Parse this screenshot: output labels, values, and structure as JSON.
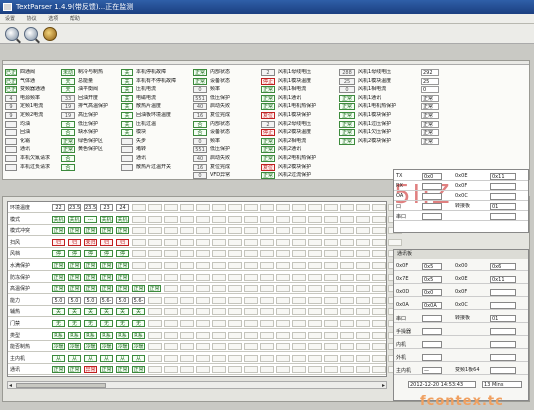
{
  "window": {
    "title": "TextParser 1.4.9(带反馈)...正在监测"
  },
  "menu": [
    "设置",
    "协议",
    "选项",
    "帮助"
  ],
  "toolbar": {
    "icons": [
      "zoom-in-icon",
      "zoom-out-icon",
      "gauge-icon"
    ]
  },
  "upper": {
    "col1": [
      {
        "st": "已正",
        "label": "四通阀"
      },
      {
        "st": "已正",
        "label": "气体通"
      },
      {
        "st": "已正",
        "label": "变频器通通"
      },
      {
        "st": "4",
        "label": "电源频率"
      },
      {
        "st": "9",
        "label": "定频1电流"
      },
      {
        "st": "9",
        "label": "定频2电流"
      },
      {
        "st": "",
        "label": "均油"
      },
      {
        "st": "",
        "label": "回油"
      },
      {
        "st": "",
        "label": "化霜"
      },
      {
        "st": "",
        "label": "通讯"
      },
      {
        "st": "",
        "label": "本机欠氟请求"
      },
      {
        "st": "",
        "label": "本机过负请求"
      }
    ],
    "col2": [
      {
        "st": "未动作",
        "label": "制冷与制热"
      },
      {
        "st": "天",
        "label": "总能量"
      },
      {
        "st": "天",
        "label": "油平衡阀"
      },
      {
        "st": "33",
        "label": "回油开度"
      },
      {
        "st": "19",
        "label": "排气高温保护"
      },
      {
        "st": "19",
        "label": "高压保护"
      },
      {
        "st": "否",
        "label": "低压保护"
      },
      {
        "st": "否",
        "label": "缺水保护"
      },
      {
        "st": "正常",
        "label": "绿色保护区"
      },
      {
        "st": "正常",
        "label": "黄色保护区"
      },
      {
        "st": "否",
        "label": ""
      },
      {
        "st": "否",
        "label": ""
      }
    ],
    "col3": [
      {
        "st": "关",
        "label": "本机停机故障"
      },
      {
        "st": "关",
        "label": "本机有不停机故障"
      },
      {
        "st": "关",
        "label": "压机电流"
      },
      {
        "st": "关",
        "label": "电磁电流"
      },
      {
        "st": "关",
        "label": "散热片温度"
      },
      {
        "st": "关",
        "label": "回油板环境温度"
      },
      {
        "st": "关",
        "label": "压机过温"
      },
      {
        "st": "关",
        "label": "模块"
      },
      {
        "st": "",
        "label": "失步"
      },
      {
        "st": "",
        "label": "堵转"
      },
      {
        "st": "",
        "label": "通讯"
      },
      {
        "st": "",
        "label": "散热片过温开关"
      }
    ],
    "col4": [
      {
        "st": "正常",
        "label": "内部状态"
      },
      {
        "st": "正常",
        "label": "设备状态"
      },
      {
        "st": "0",
        "label": "频率"
      },
      {
        "st": "551",
        "label": "低压保护"
      },
      {
        "st": "40",
        "label": "启动失败"
      },
      {
        "st": "16",
        "label": "复位完成"
      },
      {
        "st": "否",
        "label": "内部状态"
      },
      {
        "st": "否",
        "label": "设备状态"
      },
      {
        "st": "0",
        "label": "频率"
      },
      {
        "st": "551",
        "label": "低压保护"
      },
      {
        "st": "40",
        "label": "启动失败"
      },
      {
        "st": "16",
        "label": "复位完成"
      },
      {
        "st": "0",
        "label": "VFD异常"
      }
    ],
    "col5": [
      {
        "st": "2",
        "label": "风机1母线电压"
      },
      {
        "st": "停止",
        "label": "风机1模块温度"
      },
      {
        "st": "正常",
        "label": "风机1相电流"
      },
      {
        "st": "正常",
        "label": "风机1通讯"
      },
      {
        "st": "正常",
        "label": "风机1电机热保护"
      },
      {
        "st": "复位3",
        "label": "风机1模块保护"
      },
      {
        "st": "2",
        "label": "风机2母线电压"
      },
      {
        "st": "停止",
        "label": "风机2模块温度"
      },
      {
        "st": "正常",
        "label": "风机2相电流"
      },
      {
        "st": "正常",
        "label": "风机2通讯"
      },
      {
        "st": "正常",
        "label": "风机2电机热保护"
      },
      {
        "st": "复位3",
        "label": "风机2模块保护"
      },
      {
        "st": "正常",
        "label": "风机2过流保护"
      }
    ],
    "col6": [
      {
        "st": "288",
        "label": "风机1母线电压",
        "v": "292"
      },
      {
        "st": "25",
        "label": "风机1模块温度",
        "v": "25"
      },
      {
        "st": "0",
        "label": "风机1相电流",
        "v": "0"
      },
      {
        "st": "正常",
        "label": "风机1通讯",
        "v": "正常"
      },
      {
        "st": "正常",
        "label": "风机1电机热保护",
        "v": "正常"
      },
      {
        "st": "正常",
        "label": "风机1模块保护",
        "v": "正常"
      },
      {
        "st": "正常",
        "label": "风机1过压保护",
        "v": "正常"
      },
      {
        "st": "正常",
        "label": "风机1欠压保护",
        "v": "正常"
      },
      {
        "st": "正常",
        "label": "风机2模块保护",
        "v": "正常"
      }
    ]
  },
  "grid": {
    "rows": [
      {
        "label": "环境温度",
        "cells": [
          {
            "t": "22",
            "k": "num"
          },
          {
            "t": "23.5",
            "k": "num"
          },
          {
            "t": "23.5",
            "k": "num"
          },
          {
            "t": "23",
            "k": "num"
          },
          {
            "t": "24",
            "k": "num"
          }
        ]
      },
      {
        "label": "模式",
        "cells": [
          {
            "t": "关机"
          },
          {
            "t": "关机"
          },
          {
            "t": "---"
          },
          {
            "t": "关机"
          },
          {
            "t": "关机"
          }
        ]
      },
      {
        "label": "模式冲突",
        "cells": [
          {
            "t": "正常"
          },
          {
            "t": "正常"
          },
          {
            "t": "正常"
          },
          {
            "t": "正常"
          },
          {
            "t": "正常"
          }
        ]
      },
      {
        "label": "扫风",
        "cells": [
          {
            "t": "归",
            "k": "red"
          },
          {
            "t": "归",
            "k": "red"
          },
          {
            "t": "未归",
            "k": "red"
          },
          {
            "t": "归",
            "k": "red"
          },
          {
            "t": "归",
            "k": "red"
          }
        ]
      },
      {
        "label": "风档",
        "cells": [
          {
            "t": "停"
          },
          {
            "t": "停"
          },
          {
            "t": "停"
          },
          {
            "t": "停"
          },
          {
            "t": "停"
          }
        ]
      },
      {
        "label": "水满保护",
        "cells": [
          {
            "t": "正常"
          },
          {
            "t": "正常"
          },
          {
            "t": "正常"
          },
          {
            "t": "正常"
          },
          {
            "t": "正常"
          }
        ]
      },
      {
        "label": "防冻保护",
        "cells": [
          {
            "t": "正常"
          },
          {
            "t": "正常"
          },
          {
            "t": "正常"
          },
          {
            "t": "正常"
          },
          {
            "t": "正常"
          }
        ]
      },
      {
        "label": "高温保护",
        "cells": [
          {
            "t": "正常"
          },
          {
            "t": "正常"
          },
          {
            "t": "正常"
          },
          {
            "t": "正常"
          },
          {
            "t": "正常"
          },
          {
            "t": "正常"
          },
          {
            "t": "正常"
          }
        ]
      },
      {
        "label": "能力",
        "cells": [
          {
            "t": "5.0",
            "k": "num"
          },
          {
            "t": "5.0",
            "k": "num"
          },
          {
            "t": "5.0",
            "k": "num"
          },
          {
            "t": "5.6-8",
            "k": "num"
          },
          {
            "t": "5.0",
            "k": "num"
          },
          {
            "t": "5.6-8",
            "k": "num"
          }
        ]
      },
      {
        "label": "辅热",
        "cells": [
          {
            "t": "关"
          },
          {
            "t": "关"
          },
          {
            "t": "关"
          },
          {
            "t": "关"
          },
          {
            "t": "关"
          },
          {
            "t": "关"
          }
        ]
      },
      {
        "label": "门禁",
        "cells": [
          {
            "t": "无"
          },
          {
            "t": "无"
          },
          {
            "t": "无"
          },
          {
            "t": "无"
          },
          {
            "t": "无"
          },
          {
            "t": "无"
          }
        ]
      },
      {
        "label": "类型",
        "cells": [
          {
            "t": "R系列"
          },
          {
            "t": "R系列"
          },
          {
            "t": "R系列"
          },
          {
            "t": "R系列"
          },
          {
            "t": "R系列"
          },
          {
            "t": "R系列"
          }
        ]
      },
      {
        "label": "能否制热",
        "cells": [
          {
            "t": "冷暖"
          },
          {
            "t": "冷暖"
          },
          {
            "t": "冷暖"
          },
          {
            "t": "冷暖"
          },
          {
            "t": "冷暖"
          },
          {
            "t": "冷暖"
          }
        ]
      },
      {
        "label": "主内机",
        "cells": [
          {
            "t": "从"
          },
          {
            "t": "从"
          },
          {
            "t": "从"
          },
          {
            "t": "从"
          },
          {
            "t": "从"
          },
          {
            "t": "从"
          }
        ]
      },
      {
        "label": "通讯",
        "cells": [
          {
            "t": "正常"
          },
          {
            "t": "正常"
          },
          {
            "t": "异常",
            "k": "red"
          },
          {
            "t": "正常"
          },
          {
            "t": "正常"
          },
          {
            "t": "正常"
          }
        ]
      }
    ]
  },
  "right_top": {
    "rows": [
      {
        "label": "TX",
        "a": "0x0",
        "b": "0x0E",
        "c": "0x11"
      },
      {
        "label": "RX",
        "a": "",
        "b": "0x0F",
        "c": ""
      },
      {
        "label": "OA",
        "a": "",
        "b": "0x0C",
        "c": ""
      },
      {
        "label": "口",
        "a": "",
        "b": "转接板",
        "c": "01"
      },
      {
        "label": "串口",
        "a": "",
        "b": "",
        "c": ""
      }
    ],
    "big": "5IIZ"
  },
  "right_bottom": {
    "header": "通讯板",
    "rows": [
      {
        "label": "0x0F",
        "a": "0x5",
        "b": "0x00",
        "c": "0x6"
      },
      {
        "label": "0x7E",
        "a": "0x5",
        "b": "0x0E",
        "c": "0x11"
      },
      {
        "label": "0x0D",
        "a": "0x0",
        "b": "0x0F",
        "c": ""
      },
      {
        "label": "0x0A",
        "a": "0x0A",
        "b": "0x0C",
        "c": ""
      },
      {
        "label": "串口",
        "a": "",
        "b": "转接板",
        "c": "01"
      },
      {
        "label": "手操器",
        "a": "",
        "b": "",
        "c": ""
      },
      {
        "label": "内机",
        "a": "",
        "b": "",
        "c": ""
      },
      {
        "label": "外机",
        "a": "",
        "b": "",
        "c": ""
      },
      {
        "label": "主内机",
        "a": "—",
        "b": "变频1板64",
        "c": ""
      }
    ],
    "date": "2012-12-20 14:53:43",
    "elapsed": "13 Mins"
  },
  "watermark": "fcontex.tc"
}
